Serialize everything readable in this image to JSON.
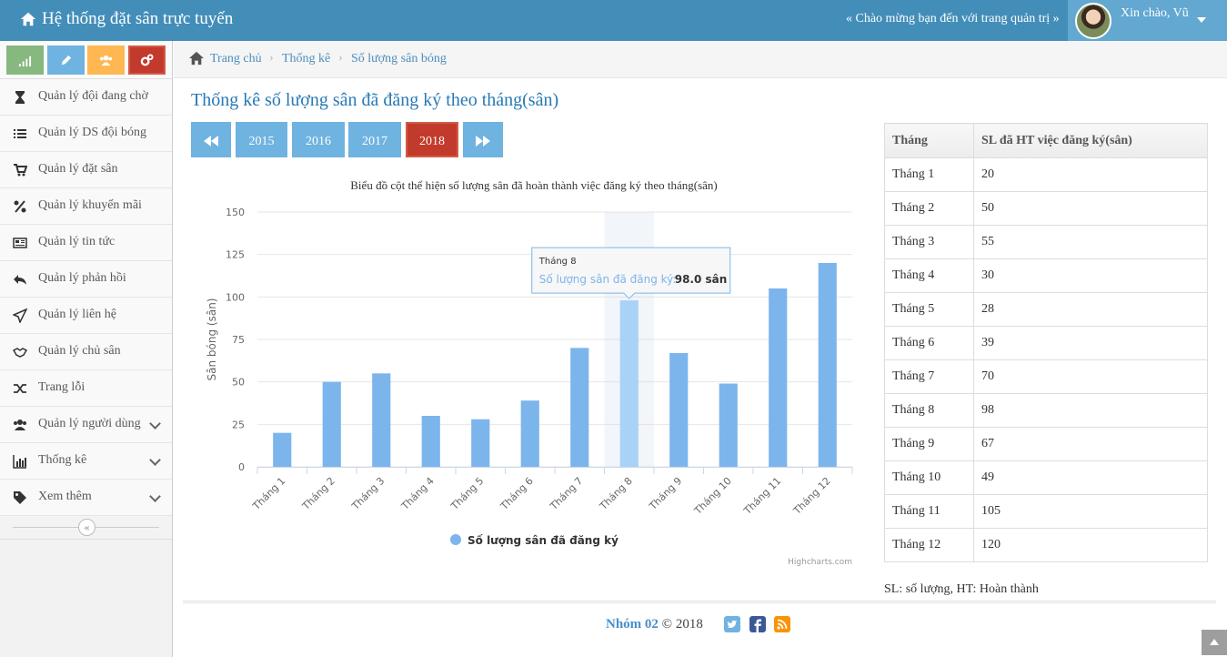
{
  "header": {
    "brand": "Hệ thống đặt sân trực tuyến",
    "welcome": "« Chào mừng bạn đến với trang quản trị »",
    "greeting": "Xin chào, Vũ"
  },
  "colors": {
    "primary": "#438eb9",
    "bar": "#7cb5ec",
    "bar_hover": "#a9d2f7",
    "active_year": "#c23a2b",
    "year_btn": "#6fb3e0"
  },
  "sidebar": {
    "shortcuts": [
      {
        "icon": "signal-icon",
        "color": "#87b87f"
      },
      {
        "icon": "pencil-icon",
        "color": "#6fb3e0"
      },
      {
        "icon": "users-icon",
        "color": "#ffb752"
      },
      {
        "icon": "cogs-icon",
        "color": "#d15b47"
      }
    ],
    "items": [
      {
        "label": "Quản lý đội đang chờ",
        "icon": "hourglass-icon"
      },
      {
        "label": "Quản lý DS đội bóng",
        "icon": "list-icon"
      },
      {
        "label": "Quản lý đặt sân",
        "icon": "cart-icon"
      },
      {
        "label": "Quản lý khuyến mãi",
        "icon": "percent-icon"
      },
      {
        "label": "Quản lý tin tức",
        "icon": "newspaper-icon"
      },
      {
        "label": "Quản lý phản hồi",
        "icon": "reply-icon"
      },
      {
        "label": "Quản lý liên hệ",
        "icon": "send-icon"
      },
      {
        "label": "Quản lý chủ sân",
        "icon": "handshake-icon"
      },
      {
        "label": "Trang lỗi",
        "icon": "random-icon"
      },
      {
        "label": "Quản lý người dùng",
        "icon": "users-icon"
      },
      {
        "label": "Thống kê",
        "icon": "bar-chart-icon"
      },
      {
        "label": "Xem thêm",
        "icon": "tag-icon"
      }
    ],
    "collapse": "«"
  },
  "breadcrumbs": [
    "Trang chủ",
    "Thống kê",
    "Số lượng sân bóng"
  ],
  "page_title": "Thống kê số lượng sân đã đăng ký theo tháng(sân)",
  "years": [
    "2015",
    "2016",
    "2017",
    "2018"
  ],
  "active_year": "2018",
  "chart_data": {
    "type": "bar",
    "title": "Biểu đồ cột thể hiện số lượng sân đã hoàn thành việc đăng ký theo tháng(sân)",
    "ylabel": "Sân bóng (sân)",
    "xlabel": "",
    "categories": [
      "Tháng 1",
      "Tháng 2",
      "Tháng 3",
      "Tháng 4",
      "Tháng 5",
      "Tháng 6",
      "Tháng 7",
      "Tháng 8",
      "Tháng 9",
      "Tháng 10",
      "Tháng 11",
      "Tháng 12"
    ],
    "series": [
      {
        "name": "Số lượng sân đã đăng ký",
        "values": [
          20,
          50,
          55,
          30,
          28,
          39,
          70,
          98,
          67,
          49,
          105,
          120
        ]
      }
    ],
    "ylim": [
      0,
      150
    ],
    "yticks": [
      0,
      25,
      50,
      75,
      100,
      125,
      150
    ],
    "grid": true,
    "legend": "bottom",
    "credits": "Highcharts.com",
    "tooltip": {
      "category": "Tháng 8",
      "series": "Số lượng sân đã đăng ký:",
      "value": "98.0 sân"
    }
  },
  "table": {
    "headers": [
      "Tháng",
      "SL đã HT việc đăng ký(sân)"
    ],
    "rows": [
      [
        "Tháng 1",
        "20"
      ],
      [
        "Tháng 2",
        "50"
      ],
      [
        "Tháng 3",
        "55"
      ],
      [
        "Tháng 4",
        "30"
      ],
      [
        "Tháng 5",
        "28"
      ],
      [
        "Tháng 6",
        "39"
      ],
      [
        "Tháng 7",
        "70"
      ],
      [
        "Tháng 8",
        "98"
      ],
      [
        "Tháng 9",
        "67"
      ],
      [
        "Tháng 10",
        "49"
      ],
      [
        "Tháng 11",
        "105"
      ],
      [
        "Tháng 12",
        "120"
      ]
    ],
    "note": "SL: số lượng, HT: Hoàn thành"
  },
  "footer": {
    "group": "Nhóm 02",
    "copyright": "© 2018",
    "social": [
      "twitter-icon",
      "facebook-icon",
      "rss-icon"
    ]
  }
}
